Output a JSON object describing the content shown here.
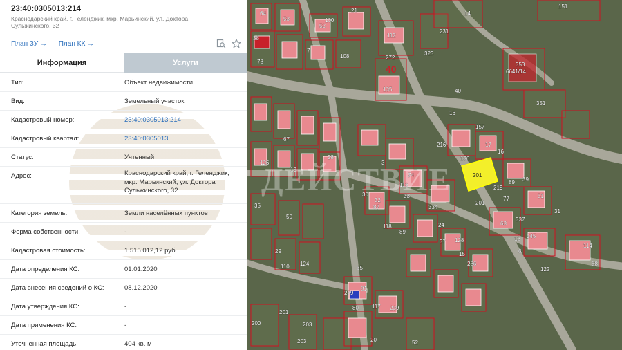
{
  "header": {
    "cadastral_title": "23:40:0305013:214",
    "address_line": "Краснодарский край, г. Геленджик, мкр. Марьинский, ул. Доктора Сульжинского, 32"
  },
  "links": {
    "plan_zu": "План ЗУ →",
    "plan_kk": "План КК →"
  },
  "icons": {
    "search": "search-document-icon",
    "favorite": "star-icon"
  },
  "tabs": {
    "info": "Информация",
    "services": "Услуги"
  },
  "fields": [
    {
      "key": "Тип:",
      "value": "Объект недвижимости"
    },
    {
      "key": "Вид:",
      "value": "Земельный участок"
    },
    {
      "key": "Кадастровый номер:",
      "value": "23:40:0305013:214"
    },
    {
      "key": "Кадастровый квартал:",
      "value": "23:40:0305013"
    },
    {
      "key": "Статус:",
      "value": "Учтенный"
    },
    {
      "key": "Адрес:",
      "value": "Краснодарский край, г. Геленджик, мкр. Марьинский, ул. Доктора Сульжинского, 32"
    },
    {
      "key": "Категория земель:",
      "value": "Земли населённых пунктов"
    },
    {
      "key": "Форма собственности:",
      "value": "-"
    },
    {
      "key": "Кадастровая стоимость:",
      "value": "1 515 012,12 руб."
    },
    {
      "key": "Дата определения КС:",
      "value": "01.01.2020"
    },
    {
      "key": "Дата внесения сведений о КС:",
      "value": "08.12.2020"
    },
    {
      "key": "Дата утверждения КС:",
      "value": "-"
    },
    {
      "key": "Дата применения КС:",
      "value": "-"
    },
    {
      "key": "Уточненная площадь:",
      "value": "404 кв. м"
    }
  ],
  "map": {
    "highlight_label": "201",
    "block_number": "40",
    "watermark": "ДЕЙСТВИЕ",
    "colors": {
      "parcel_border": "#d01020",
      "highlight": "#f3ef2a",
      "building": "#e8898f"
    },
    "parcel_labels": [
      "64",
      "53",
      "52",
      "100",
      "21",
      "231",
      "112",
      "272",
      "323",
      "14",
      "40",
      "135",
      "157",
      "216",
      "136",
      "17",
      "16",
      "201",
      "219",
      "89",
      "39",
      "77",
      "51",
      "31",
      "6",
      "63",
      "337",
      "18",
      "245",
      "114",
      "122",
      "88",
      "353",
      "6641/14",
      "351",
      "151",
      "38",
      "78",
      "7",
      "108",
      "24",
      "32",
      "37",
      "128",
      "286",
      "15",
      "81",
      "80",
      "117",
      "239",
      "279",
      "200",
      "201",
      "203",
      "203",
      "20",
      "52",
      "3",
      "74",
      "116",
      "30",
      "33",
      "87",
      "118",
      "334",
      "89",
      "16",
      "19",
      "28",
      "35",
      "50",
      "29",
      "110",
      "124",
      "126",
      "67",
      "65"
    ]
  }
}
